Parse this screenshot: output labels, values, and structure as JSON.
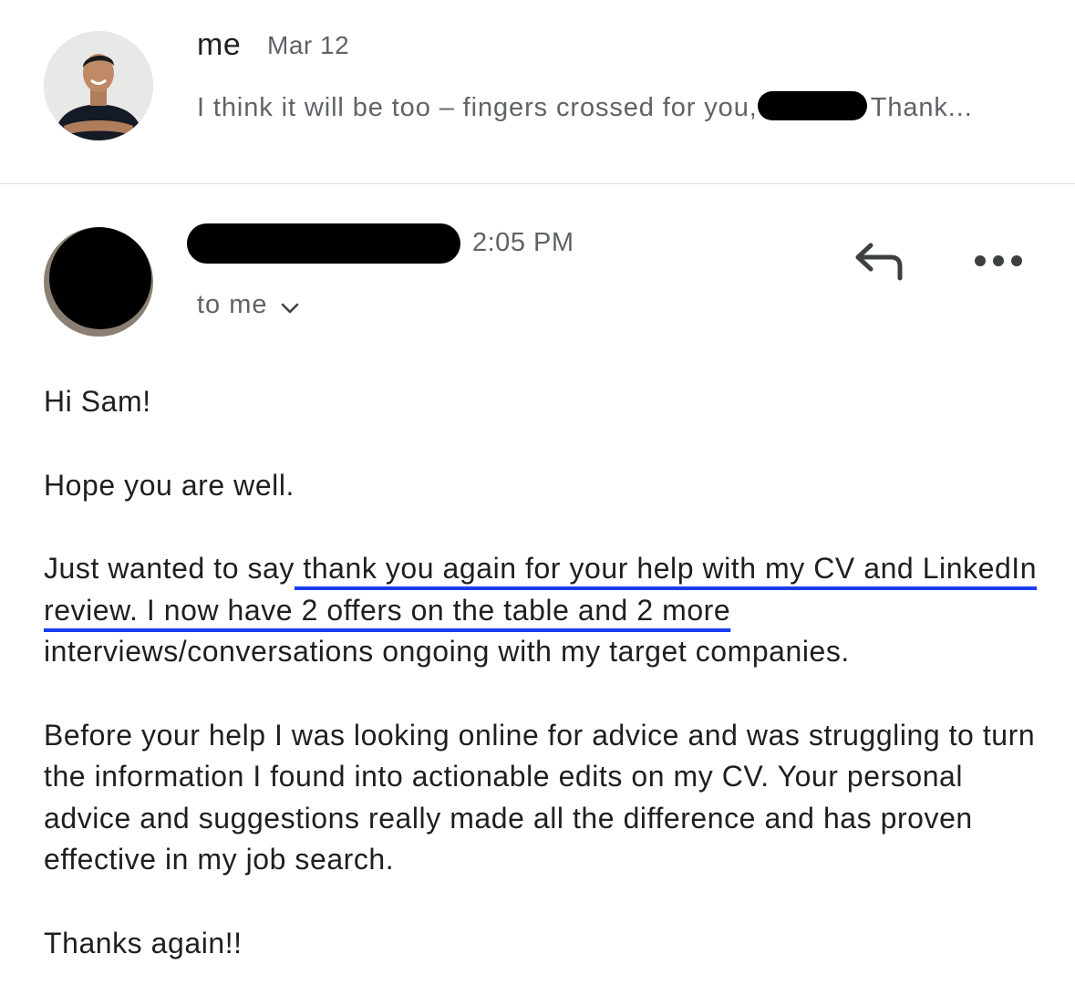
{
  "previous_message": {
    "sender": "me",
    "date": "Mar 12",
    "snippet_before": "I think it will be too – fingers crossed for you,",
    "snippet_after": "Thank..."
  },
  "message": {
    "time": "2:05 PM",
    "recipient_label": "to me",
    "greeting": "Hi Sam!",
    "p1": "Hope you are well.",
    "p2_before": "Just wanted to say",
    "p2_highlight": " thank you again for your help with my CV and LinkedIn review. I now have 2 offers on the table and 2 more",
    "p2_after": " interviews/conversations ongoing with my target companies.",
    "p3": "Before your help I was looking online for advice and was struggling to turn the information I found into actionable edits on my CV. Your personal advice and suggestions really made all the difference and has proven effective in my job search.",
    "closing": "Thanks again!!"
  },
  "icons": {
    "reply": "reply-icon",
    "more": "more-horizontal-icon",
    "expand": "chevron-down-icon"
  },
  "colors": {
    "highlight_underline": "#1a3cf0",
    "secondary_text": "#5f6368",
    "redaction": "#000000"
  }
}
